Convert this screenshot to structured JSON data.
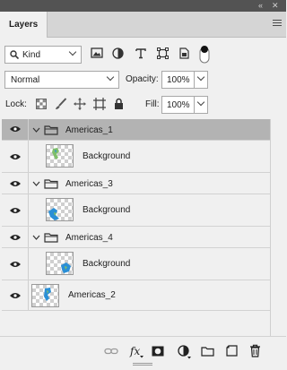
{
  "panel": {
    "tab_label": "Layers",
    "collapse_glyph": "«",
    "close_glyph": "»"
  },
  "filter": {
    "kind_label": "Kind",
    "icons": [
      "image-filter-icon",
      "adjustment-filter-icon",
      "type-filter-icon",
      "shape-filter-icon",
      "smart-object-filter-icon",
      "filter-toggle-icon"
    ]
  },
  "blend": {
    "mode": "Normal",
    "opacity_label": "Opacity:",
    "opacity_value": "100%"
  },
  "lock": {
    "label": "Lock:",
    "fill_label": "Fill:",
    "fill_value": "100%"
  },
  "layers": [
    {
      "name": "Americas_1",
      "type": "group",
      "selected": true
    },
    {
      "name": "Background",
      "type": "layer",
      "nested": true
    },
    {
      "name": "Americas_3",
      "type": "group"
    },
    {
      "name": "Background",
      "type": "layer",
      "nested": true
    },
    {
      "name": "Americas_4",
      "type": "group"
    },
    {
      "name": "Background",
      "type": "layer",
      "nested": true
    },
    {
      "name": "Americas_2",
      "type": "layer"
    }
  ],
  "footer_icons": [
    "link-layers-icon",
    "fx-icon",
    "add-mask-icon",
    "adjustment-layer-icon",
    "new-group-icon",
    "new-layer-icon",
    "delete-layer-icon"
  ],
  "colors": {
    "selected_row": "#b3b3b3",
    "panel_bg": "#f0f0f0",
    "titlebar": "#535353",
    "map_blue": "#2a8fd6",
    "map_green": "#7fbf6a"
  }
}
